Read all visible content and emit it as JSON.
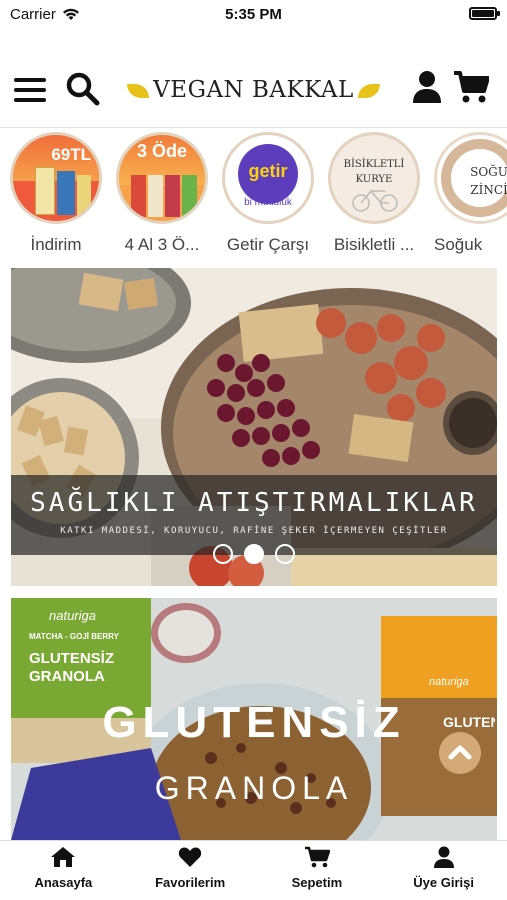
{
  "status_bar": {
    "carrier": "Carrier",
    "time": "5:35 PM"
  },
  "header": {
    "logo_text": "VEGAN BAKKAL"
  },
  "categories": [
    {
      "label": "İndirim",
      "badge": "69TL"
    },
    {
      "label": "4 Al 3 Ö...",
      "badge": "3 Öde"
    },
    {
      "label": "Getir Çarşı",
      "badge": "getir",
      "sub": "bi mutluluk"
    },
    {
      "label": "Bisikletli ...",
      "badge": "BİSİKLETLİ KURYE"
    },
    {
      "label": "Soğuk",
      "badge": "SOĞU ZİNCİ"
    }
  ],
  "banners": {
    "first": {
      "title": "SAĞLIKLI ATIŞTIRMALIKLAR",
      "subtitle": "KATKI MADDESİ, KORUYUCU, RAFİNE ŞEKER İÇERMEYEN ÇEŞİTLER",
      "pager_active": 2,
      "pager_total": 3
    },
    "second": {
      "title": "GLUTENSİZ",
      "subtitle": "GRANOLA",
      "pack_brand": "naturiga",
      "pack_flavor": "MATCHA - GOJİ BERRY",
      "pack_title": "GLUTENSİZ GRANOLA",
      "pack_right_brand": "naturiga",
      "pack_right_title": "GLUTENSİ"
    }
  },
  "tabbar": [
    {
      "label": "Anasayfa",
      "icon": "home-icon"
    },
    {
      "label": "Favorilerim",
      "icon": "heart-icon"
    },
    {
      "label": "Sepetim",
      "icon": "cart-icon"
    },
    {
      "label": "Üye Girişi",
      "icon": "user-icon"
    }
  ]
}
